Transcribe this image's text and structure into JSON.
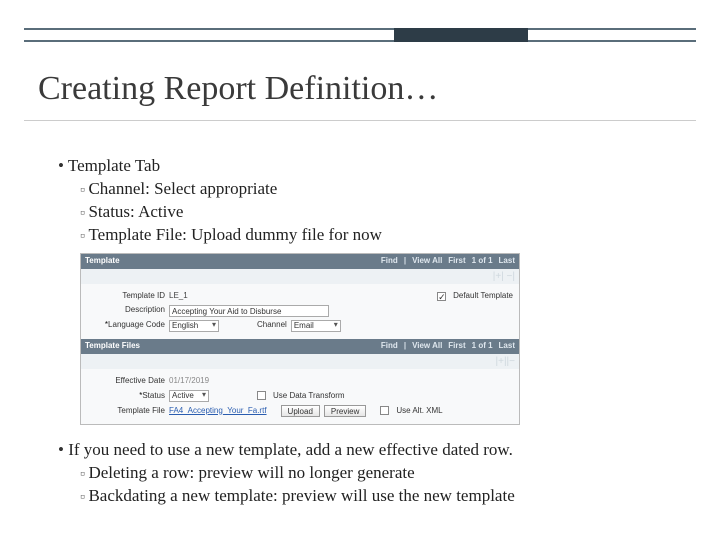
{
  "slide": {
    "title": "Creating Report Definition…",
    "bullet1": "Template Tab",
    "sub1": [
      "Channel: Select appropriate",
      "Status: Active",
      "Template File: Upload dummy file for now"
    ],
    "bullet2": "If you need to use a new template, add a new effective dated row.",
    "sub2": [
      "Deleting a row: preview will no longer generate",
      "Backdating a new template: preview will use the new template"
    ]
  },
  "panel": {
    "template_bar": "Template",
    "nav_find": "Find",
    "nav_viewall": "View All",
    "nav_first": "First",
    "nav_count": "1 of 1",
    "nav_last": "Last",
    "toggle": "|+| −|",
    "labels": {
      "template_id": "Template ID",
      "description": "Description",
      "language_code": "Language Code",
      "channel": "Channel",
      "default_template": "Default Template",
      "files_bar": "Template Files",
      "effective_date": "Effective Date",
      "status": "Status",
      "template_file": "Template File",
      "use_data_transform": "Use Data Transform",
      "use_alt_xml": "Use Alt. XML"
    },
    "values": {
      "template_id": "LE_1",
      "description": "Accepting Your Aid to Disburse",
      "language_code": "English",
      "channel": "Email",
      "effective_date": "01/17/2019",
      "status": "Active",
      "template_file": "FA4_Accepting_Your_Fa.rtf"
    },
    "buttons": {
      "upload": "Upload",
      "preview": "Preview"
    },
    "files_toggle": "|+||−"
  }
}
